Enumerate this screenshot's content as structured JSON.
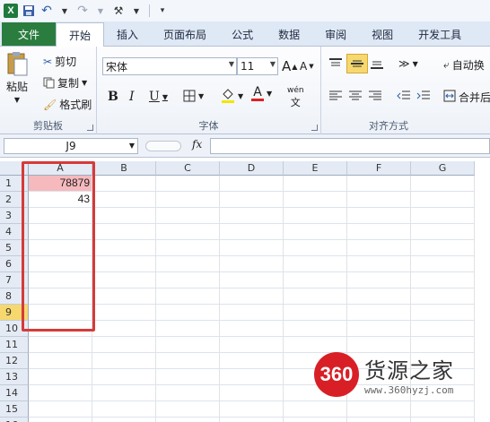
{
  "qat": {
    "logo": "X",
    "undo": "↶",
    "redo": "↷",
    "extra": "⚒",
    "sep": "|"
  },
  "tabs": [
    {
      "label": "文件"
    },
    {
      "label": "开始"
    },
    {
      "label": "插入"
    },
    {
      "label": "页面布局"
    },
    {
      "label": "公式"
    },
    {
      "label": "数据"
    },
    {
      "label": "审阅"
    },
    {
      "label": "视图"
    },
    {
      "label": "开发工具"
    }
  ],
  "ribbon": {
    "clipboard": {
      "paste": "粘贴",
      "cut": "剪切",
      "copy": "复制",
      "painter": "格式刷",
      "label": "剪贴板"
    },
    "font": {
      "name": "宋体",
      "size": "11",
      "grow": "A",
      "shrink": "A",
      "bold": "B",
      "italic": "I",
      "underline": "U",
      "label": "字体",
      "wen": "wén"
    },
    "align": {
      "wrap": "自动换",
      "merge": "合并后",
      "label": "对齐方式"
    }
  },
  "formula_bar": {
    "name_box": "J9",
    "fx": "fx",
    "value": ""
  },
  "grid": {
    "columns": [
      "A",
      "B",
      "C",
      "D",
      "E",
      "F",
      "G"
    ],
    "rows": [
      "1",
      "2",
      "3",
      "4",
      "5",
      "6",
      "7",
      "8",
      "9",
      "10",
      "11",
      "12",
      "13",
      "14",
      "15",
      "16"
    ],
    "cells": {
      "A1": "78879",
      "A2": "43"
    },
    "selected_row": "9",
    "colors": {
      "highlight_border": "#d63a3a",
      "cell_fill": "#f6b9bd",
      "selected_row": "#f6d86e"
    }
  },
  "watermark": {
    "logo": "360",
    "name": "货源之家",
    "url": "www.360hyzj.com"
  }
}
